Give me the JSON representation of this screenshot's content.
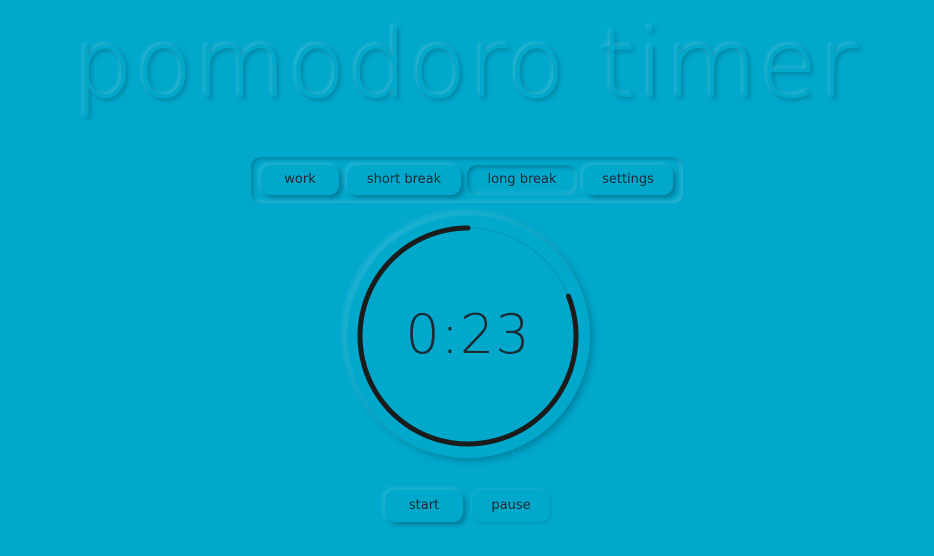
{
  "app": {
    "title": "pomodoro timer"
  },
  "nav": {
    "items": [
      {
        "label": "work"
      },
      {
        "label": "short break"
      },
      {
        "label": "long break"
      },
      {
        "label": "settings"
      }
    ],
    "active_index": 2
  },
  "timer": {
    "display": "0:23",
    "progress_fraction": 0.81
  },
  "controls": {
    "start_label": "start",
    "pause_label": "pause"
  },
  "colors": {
    "background": "#00a8cc",
    "ink": "#1b2a33",
    "ring_stroke": "#1b1b1b"
  }
}
